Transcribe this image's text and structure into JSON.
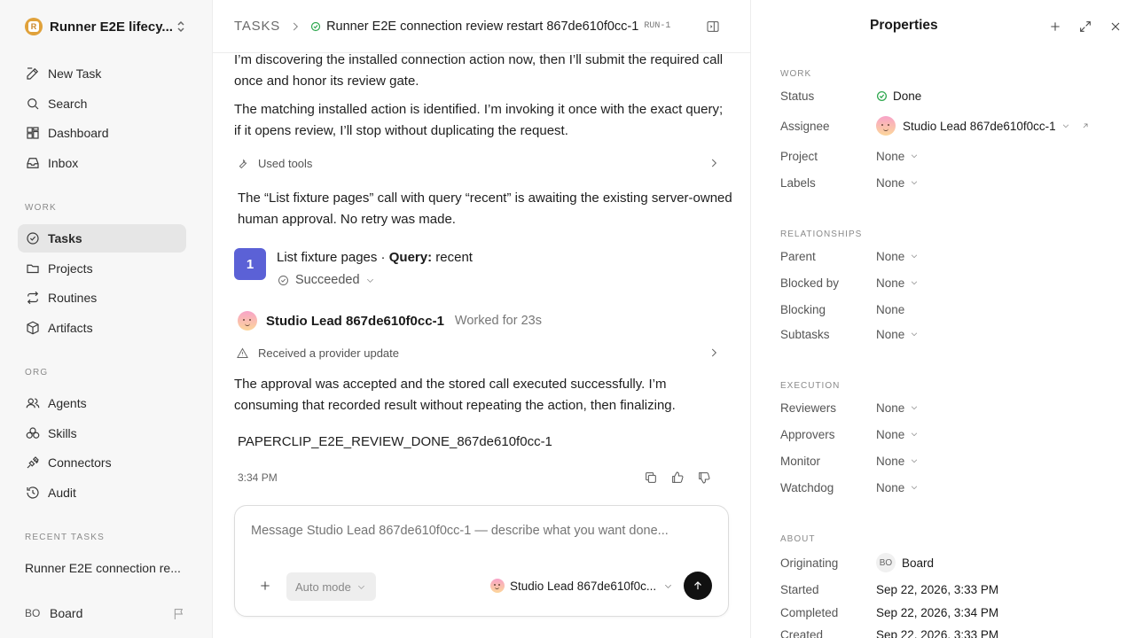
{
  "sidebar": {
    "workspace": "Runner E2E lifecy...",
    "workspace_logo": "R",
    "nav_top": [
      {
        "label": "New Task",
        "icon": "edit-icon"
      },
      {
        "label": "Search",
        "icon": "search-icon"
      },
      {
        "label": "Dashboard",
        "icon": "dashboard-icon"
      },
      {
        "label": "Inbox",
        "icon": "inbox-icon"
      }
    ],
    "work_label": "WORK",
    "nav_work": [
      {
        "label": "Tasks",
        "icon": "check-circle-icon",
        "active": true
      },
      {
        "label": "Projects",
        "icon": "folder-icon"
      },
      {
        "label": "Routines",
        "icon": "repeat-icon"
      },
      {
        "label": "Artifacts",
        "icon": "box-icon"
      }
    ],
    "org_label": "ORG",
    "nav_org": [
      {
        "label": "Agents",
        "icon": "users-icon"
      },
      {
        "label": "Skills",
        "icon": "skills-icon"
      },
      {
        "label": "Connectors",
        "icon": "plug-icon"
      },
      {
        "label": "Audit",
        "icon": "history-icon"
      }
    ],
    "recent_label": "RECENT TASKS",
    "recent_task": "Runner E2E connection re...",
    "board_initials": "BO",
    "board_label": "Board"
  },
  "header": {
    "root": "TASKS",
    "title": "Runner E2E connection review restart 867de610f0cc-1",
    "run_id": "RUN-1"
  },
  "thread": {
    "para1": "I’m discovering the installed connection action now, then I’ll submit the required call once and honor its review gate.",
    "para2": "The matching installed action is identified. I’m invoking it once with the exact query; if it opens review, I’ll stop without duplicating the request.",
    "used_tools": "Used tools",
    "para3": "The “List fixture pages” call with query “recent” is awaiting the existing server-owned human approval. No retry was made.",
    "step": {
      "number": "1",
      "title_prefix": "List fixture pages · ",
      "query_label": "Query:",
      "query_value": " recent",
      "status": "Succeeded"
    },
    "agent_name": "Studio Lead 867de610f0cc-1",
    "agent_meta": "Worked for 23s",
    "provider_update": "Received a provider update",
    "para4": "The approval was accepted and the stored call executed successfully. I’m consuming that recorded result without repeating the action, then finalizing.",
    "done_code": "PAPERCLIP_E2E_REVIEW_DONE_867de610f0cc-1",
    "time": "3:34 PM"
  },
  "composer": {
    "placeholder": "Message Studio Lead 867de610f0cc-1 — describe what you want done...",
    "mode": "Auto mode",
    "agent": "Studio Lead 867de610f0c..."
  },
  "properties": {
    "title": "Properties",
    "work_label": "WORK",
    "status_label": "Status",
    "status_value": "Done",
    "assignee_label": "Assignee",
    "assignee_value": "Studio Lead 867de610f0cc-1",
    "project_label": "Project",
    "project_value": "None",
    "labels_label": "Labels",
    "labels_value": "None",
    "relationships_label": "RELATIONSHIPS",
    "parent_label": "Parent",
    "parent_value": "None",
    "blocked_by_label": "Blocked by",
    "blocked_by_value": "None",
    "blocking_label": "Blocking",
    "blocking_value": "None",
    "subtasks_label": "Subtasks",
    "subtasks_value": "None",
    "execution_label": "EXECUTION",
    "reviewers_label": "Reviewers",
    "reviewers_value": "None",
    "approvers_label": "Approvers",
    "approvers_value": "None",
    "monitor_label": "Monitor",
    "monitor_value": "None",
    "watchdog_label": "Watchdog",
    "watchdog_value": "None",
    "about_label": "ABOUT",
    "originating_label": "Originating",
    "originating_initials": "BO",
    "originating_value": "Board",
    "started_label": "Started",
    "started_value": "Sep 22, 2026, 3:33 PM",
    "completed_label": "Completed",
    "completed_value": "Sep 22, 2026, 3:34 PM",
    "created_label": "Created",
    "created_value": "Sep 22, 2026, 3:33 PM"
  },
  "colors": {
    "accent": "#5b61d6",
    "success": "#2fa84f",
    "sidebar_bg": "#f7f7f7"
  }
}
